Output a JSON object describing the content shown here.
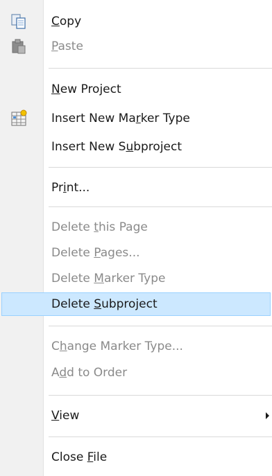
{
  "menu": {
    "copy": {
      "label": "Copy",
      "mnemonic_index": 0,
      "icon": "copy-icon",
      "enabled": true
    },
    "paste": {
      "label": "Paste",
      "mnemonic_index": 0,
      "icon": "paste-icon",
      "enabled": false
    },
    "new_project": {
      "label": "New Project",
      "mnemonic_index": 0,
      "enabled": true
    },
    "insert_marker_type": {
      "label": "Insert New Marker Type",
      "mnemonic_index": 13,
      "icon": "marker-type-icon",
      "enabled": true
    },
    "insert_subproject": {
      "label": "Insert New Subproject",
      "mnemonic_index": 12,
      "enabled": true
    },
    "print": {
      "label": "Print...",
      "mnemonic_index": 2,
      "enabled": true
    },
    "delete_this_page": {
      "label": "Delete this Page",
      "mnemonic_index": 7,
      "enabled": false
    },
    "delete_pages": {
      "label": "Delete Pages...",
      "mnemonic_index": 7,
      "enabled": false
    },
    "delete_marker_type": {
      "label": "Delete Marker Type",
      "mnemonic_index": 7,
      "enabled": false
    },
    "delete_subproject": {
      "label": "Delete Subproject",
      "mnemonic_index": 7,
      "enabled": true,
      "highlighted": true
    },
    "change_marker_type": {
      "label": "Change Marker Type...",
      "mnemonic_index": 1,
      "enabled": false
    },
    "add_to_order": {
      "label": "Add to Order",
      "mnemonic_index": 1,
      "enabled": false
    },
    "view": {
      "label": "View",
      "mnemonic_index": 0,
      "enabled": true,
      "submenu_icon": "submenu-arrow-icon"
    },
    "close_file": {
      "label": "Close File",
      "mnemonic_index": 6,
      "enabled": true
    }
  },
  "colors": {
    "highlight_bg": "#cce8ff",
    "highlight_border": "#99d1ff",
    "disabled_text": "#8a8a8a",
    "text": "#1a1a1a"
  }
}
